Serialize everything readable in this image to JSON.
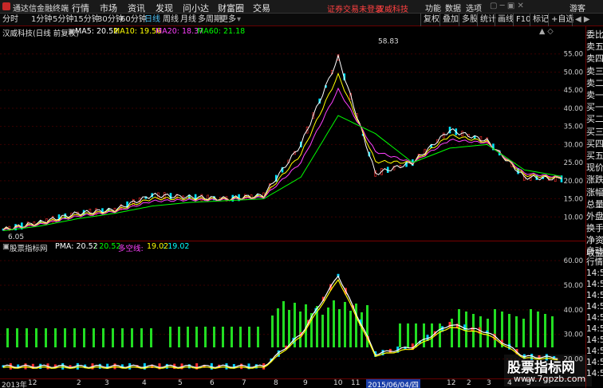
{
  "titlebar": {
    "app_title": "通达信金融终端",
    "menu": [
      "行情",
      "市场",
      "资讯",
      "发现",
      "问小达",
      "财富圈",
      "交易"
    ],
    "alert": "证券交易未登录",
    "stock_name_red": "汉威科技",
    "right_menu": [
      "功能",
      "数据",
      "选项",
      "游客"
    ]
  },
  "toolbar": {
    "periods": [
      "分时",
      "1分钟",
      "5分钟",
      "15分钟",
      "30分钟",
      "60分钟",
      "日线",
      "周线",
      "月线",
      "多周期",
      "更多"
    ],
    "active_period": "日线",
    "tools": [
      "复权",
      "叠加",
      "多股",
      "统计",
      "画线",
      "F10",
      "标记",
      "+自选"
    ]
  },
  "main_chart": {
    "stock_label": "汉威科技(日线 前复权)",
    "ma5": "MA5: 20.52",
    "ma10": "MA10: 19.56",
    "ma20": "MA20: 18.37",
    "ma60": "MA60: 21.18",
    "ma5_color": "#ffffff",
    "ma10_color": "#ffff00",
    "ma20_color": "#ff40ff",
    "ma60_color": "#00ff00",
    "high_label": "58.83",
    "low_label": "6.05",
    "y_ticks": [
      "55.00",
      "50.00",
      "45.00",
      "40.00",
      "35.00",
      "30.00",
      "25.00",
      "20.00",
      "15.00",
      "10.00"
    ]
  },
  "indicator_chart": {
    "name": "股票指标网",
    "pma": "PMA: 20.52",
    "val2": ": 20.52",
    "dk_label": "多空线:",
    "dk_val": "19.02",
    "val3": ": 19.02",
    "y_ticks": [
      "60.00",
      "50.00",
      "40.00",
      "30.00",
      "20.00"
    ]
  },
  "right_panel": {
    "labels": [
      "委比",
      "卖五",
      "卖四",
      "卖三",
      "卖二",
      "卖一",
      "买一",
      "买二",
      "买三",
      "买四",
      "买五",
      "现价",
      "涨跌",
      "涨幅",
      "总量",
      "外盘",
      "换手",
      "净资",
      "收益"
    ],
    "lower_labels": [
      "自动",
      "行情",
      "14:5",
      "14:5",
      "14:5",
      "14:5",
      "14:5",
      "14:5",
      "14:5",
      "14:5",
      "14:5",
      "14:5"
    ]
  },
  "xaxis": {
    "labels": [
      "2013年",
      "12",
      "2",
      "3",
      "4",
      "5",
      "6",
      "7",
      "8",
      "9",
      "10",
      "11",
      "12",
      "2",
      "3",
      "4",
      "5"
    ],
    "highlight": "2015/06/04/四"
  },
  "watermark": {
    "line1": "股票指标网",
    "line2": "www.7gpzb.com"
  },
  "chart_data": {
    "type": "line",
    "title": "汉威科技(日线 前复权)",
    "xlabel": "",
    "ylabel": "",
    "ylim": [
      5,
      60
    ],
    "x": [
      "2013-12",
      "2014-02",
      "2014-04",
      "2014-06",
      "2014-08",
      "2014-10",
      "2014-12",
      "2015-02",
      "2015-04",
      "2015-06",
      "2015-08",
      "2015-10",
      "2015-12",
      "2016-02",
      "2016-04",
      "2016-05"
    ],
    "series": [
      {
        "name": "MA5",
        "values": [
          6.5,
          8.5,
          11,
          12,
          16,
          15.5,
          15,
          16,
          30,
          54,
          22,
          25,
          34,
          31,
          21,
          20.5
        ]
      },
      {
        "name": "MA60",
        "values": [
          6.2,
          7.5,
          9.5,
          11,
          13,
          14,
          14.5,
          15,
          21,
          38,
          33,
          25,
          29,
          30,
          23,
          21.2
        ]
      }
    ]
  }
}
